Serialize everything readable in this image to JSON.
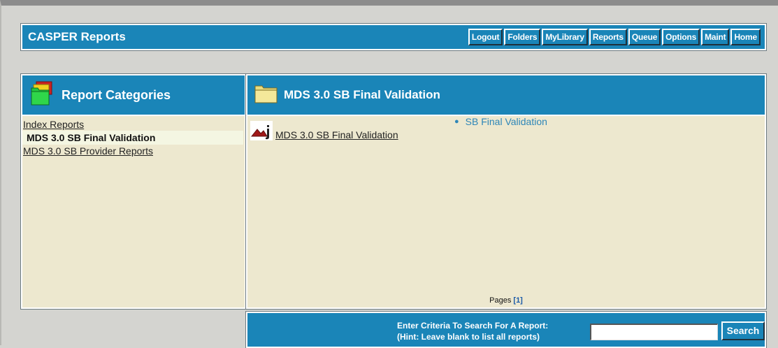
{
  "header": {
    "title": "CASPER Reports",
    "nav": [
      {
        "label": "Logout",
        "icon": ""
      },
      {
        "label": "Folders",
        "icon": ""
      },
      {
        "label": "MyLibrary",
        "icon": ""
      },
      {
        "label": "Reports",
        "icon": ""
      },
      {
        "label": "Queue",
        "icon": ""
      },
      {
        "label": "Options",
        "icon": ""
      },
      {
        "label": "Maint",
        "icon": ""
      },
      {
        "label": "Home",
        "icon": ""
      }
    ]
  },
  "categories": {
    "title": "Report Categories",
    "icon": "folders-icon",
    "items": [
      {
        "label": "Index Reports",
        "active": false
      },
      {
        "label": "MDS 3.0 SB Final Validation",
        "active": true
      },
      {
        "label": "MDS 3.0 SB Provider Reports",
        "active": false
      }
    ]
  },
  "main": {
    "title": "MDS 3.0 SB Final Validation",
    "icon": "folder-icon",
    "report": {
      "icon": "report-file-icon",
      "label": "MDS 3.0 SB Final Validation",
      "sub_items": [
        "SB Final Validation"
      ]
    },
    "pages_label": "Pages",
    "pages": [
      "[1]"
    ]
  },
  "search": {
    "hint_line1": "Enter Criteria To Search For A Report:",
    "hint_line2": "(Hint: Leave blank to list all reports)",
    "input_value": "",
    "button_label": "Search"
  },
  "colors": {
    "brand_blue": "#1a85b8",
    "panel_bg": "#ede8cf",
    "page_bg": "#d4d4d0",
    "link_blue": "#2d86b8"
  }
}
